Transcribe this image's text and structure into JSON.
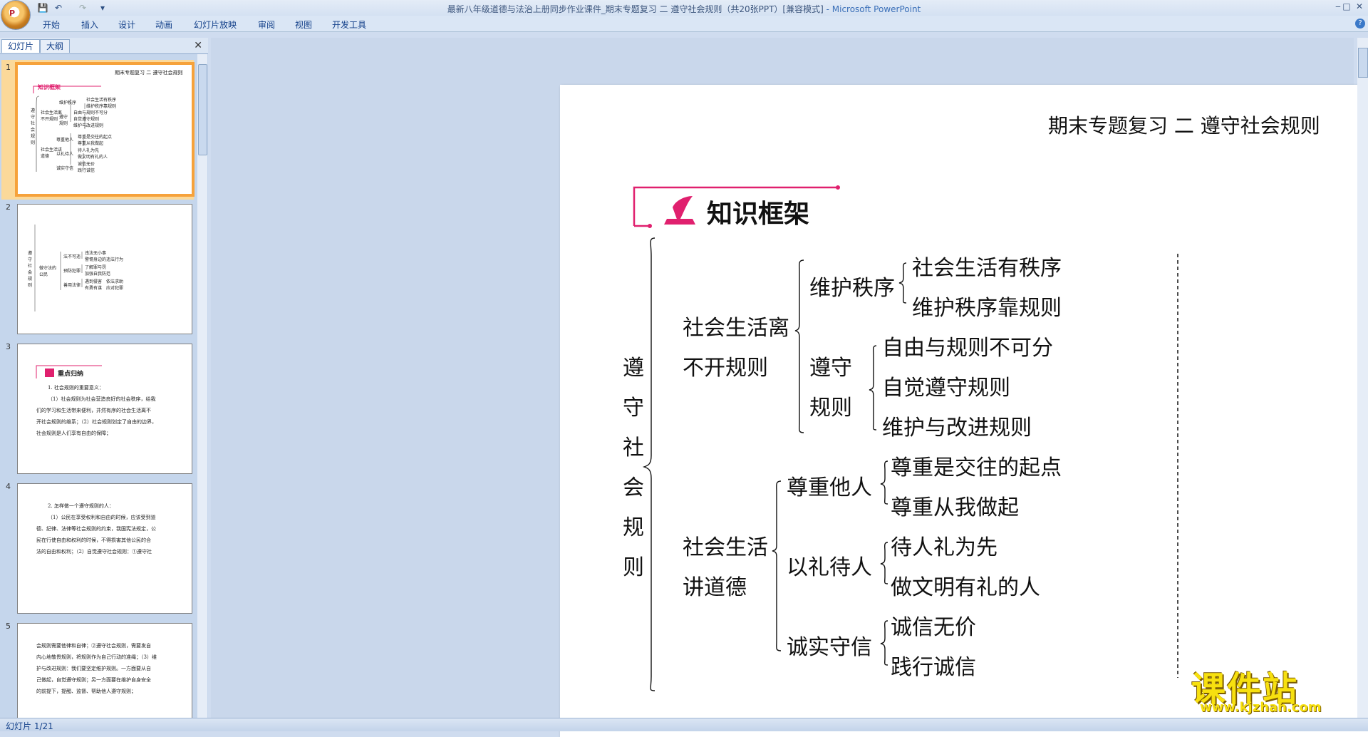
{
  "window": {
    "title": "最新八年级道德与法治上册同步作业课件_期末专题复习 二 遵守社会规则（共20张PPT）[兼容模式]",
    "app": " - Microsoft PowerPoint",
    "minimize": "‒",
    "maximize": "□",
    "close": "✕"
  },
  "office_button": "P",
  "qat": {
    "save": "💾",
    "undo": "↶",
    "redo": "↷",
    "more": "▾"
  },
  "ribbon": {
    "tabs": [
      "开始",
      "插入",
      "设计",
      "动画",
      "幻灯片放映",
      "审阅",
      "视图",
      "开发工具"
    ],
    "help": "?"
  },
  "left_pane": {
    "tabs": [
      "幻灯片",
      "大纲"
    ],
    "close": "✕",
    "slide_numbers": [
      "1",
      "2",
      "3",
      "4",
      "5"
    ],
    "thumb1": {
      "header": "期末专题复习 二 遵守社会规则",
      "section": "知识框架",
      "root": "遵守社会规则",
      "b1": "社会生活离不开规则",
      "b1a": "维护秩序",
      "b1a1": "社会生活有秩序",
      "b1a2": "维护秩序靠规则",
      "b1b": "遵守规则",
      "b1b1": "自由与规则不可分",
      "b1b2": "自觉遵守规则",
      "b1b3": "维护与改进规则",
      "b2": "社会生活讲道德",
      "b2a": "尊重他人",
      "b2a1": "尊重是交往的起点",
      "b2a2": "尊重从我做起",
      "b2b": "以礼待人",
      "b2b1": "待人礼为先",
      "b2b2": "做文明有礼的人",
      "b2c": "诚实守信",
      "b2c1": "诚信无价",
      "b2c2": "践行诚信"
    },
    "thumb2": {
      "root": "遵守社会规则",
      "b": "做守法的公民",
      "b1": "法不可违",
      "b1a": "违法无小事",
      "b1b": "警惕身边的违法行为",
      "b2": "预防犯罪",
      "b2a": "了解罪与罚",
      "b2b": "加强自我防范",
      "b3": "善用法律",
      "b3a": "遇到侵害　依法求助",
      "b3b": "有勇有谋　应对犯罪"
    },
    "thumb3": {
      "section": "重点归纳",
      "lines": [
        "1. 社会规则的重要意义：",
        "（1）社会规则为社会营造良好的社会秩序，给我",
        "们的学习和生活带来便利，井然有序的社会生活离不",
        "开社会规则的维系；（2）社会规则划定了自由的边界，",
        "社会规则是人们享有自由的保障；"
      ]
    },
    "thumb4": {
      "lines": [
        "2. 怎样做一个遵守规则的人：",
        "（1）公民在享受权利和自由的时候，应该受到道",
        "德、纪律、法律等社会规则的约束，我国宪法规定，公",
        "民在行使自由和权利的时候，不得损害其他公民的合",
        "法的自由和权利；（2）自觉遵守社会规则：①遵守社"
      ]
    },
    "thumb5": {
      "lines": [
        "会规则需要他律和自律；②遵守社会规则，需要发自",
        "内心地敬畏规则，将规则作为自己行动的准绳；（3）维",
        "护与改进规则：我们要坚定维护规则。一方面要从自",
        "己做起，自觉遵守规则；另一方面要在维护自身安全",
        "的前提下，提醒、监督、帮助他人遵守规则；"
      ]
    }
  },
  "slide": {
    "header": "期末专题复习 二 遵守社会规则",
    "section_title": "知识框架",
    "root_chars": [
      "遵",
      "守",
      "社",
      "会",
      "规",
      "则"
    ],
    "branch1": {
      "lines": [
        "社会生活离",
        "不开规则"
      ],
      "sub1": {
        "label": "维护秩序",
        "leaves": [
          "社会生活有秩序",
          "维护秩序靠规则"
        ]
      },
      "sub2": {
        "lines": [
          "遵守",
          "规则"
        ],
        "leaves": [
          "自由与规则不可分",
          "自觉遵守规则",
          "维护与改进规则"
        ]
      }
    },
    "branch2": {
      "lines": [
        "社会生活",
        "讲道德"
      ],
      "sub1": {
        "label": "尊重他人",
        "leaves": [
          "尊重是交往的起点",
          "尊重从我做起"
        ]
      },
      "sub2": {
        "label": "以礼待人",
        "leaves": [
          "待人礼为先",
          "做文明有礼的人"
        ]
      },
      "sub3": {
        "label": "诚实守信",
        "leaves": [
          "诚信无价",
          "践行诚信"
        ]
      }
    }
  },
  "status": {
    "slide_indicator": "幻灯片 1/21"
  },
  "watermark": {
    "cn": "课件站",
    "url": "www.kjzhan.com"
  },
  "colors": {
    "accent_pink": "#e0206e",
    "thumb_selected": "#f6a23b"
  }
}
